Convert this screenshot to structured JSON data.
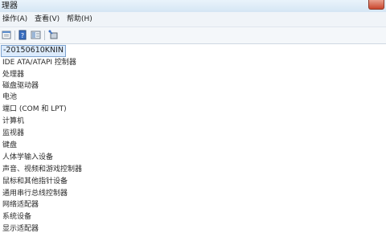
{
  "window": {
    "title": "理器"
  },
  "menu": {
    "items": [
      "操作(A)",
      "查看(V)",
      "帮助(H)"
    ]
  },
  "toolbar": {
    "buttons": [
      "properties-icon",
      "help-icon",
      "view-icon",
      "scan-hardware-icon"
    ]
  },
  "tree": {
    "root": "-20150610KNIN",
    "nodes": [
      "IDE ATA/ATAPI 控制器",
      "处理器",
      "磁盘驱动器",
      "电池",
      "端口 (COM 和 LPT)",
      "计算机",
      "监视器",
      "键盘",
      "人体学输入设备",
      "声音、视频和游戏控制器",
      "鼠标和其他指针设备",
      "通用串行总线控制器",
      "网络适配器",
      "系统设备",
      "显示适配器"
    ]
  }
}
